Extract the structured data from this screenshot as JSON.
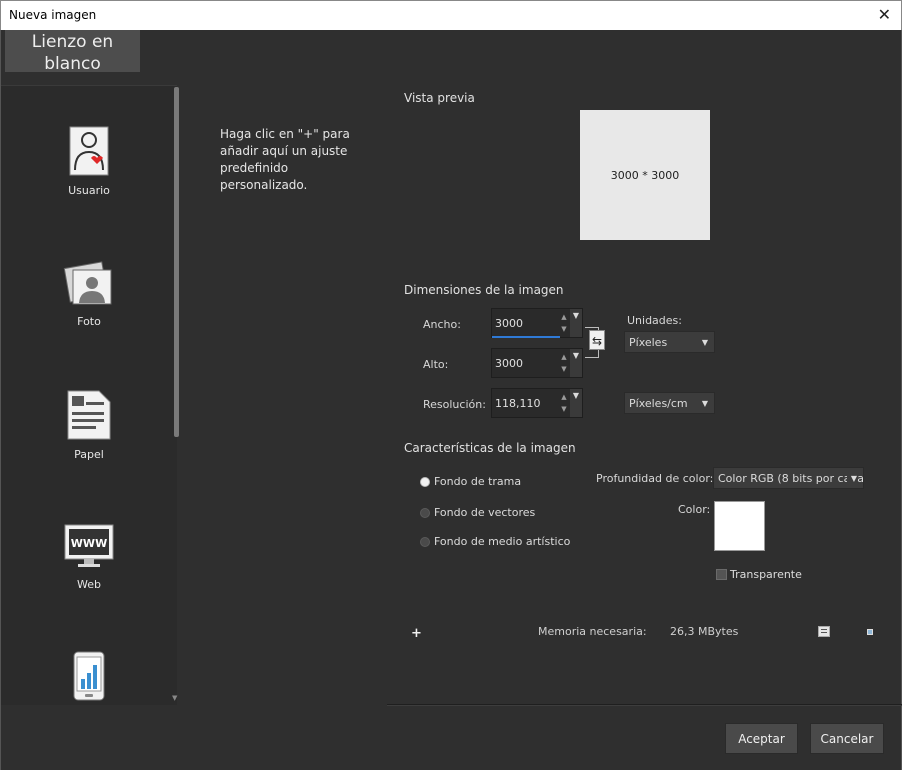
{
  "window": {
    "title": "Nueva imagen",
    "close_glyph": "✕"
  },
  "top_tab": {
    "label": "Lienzo en blanco"
  },
  "presets": [
    {
      "label": "Usuario",
      "icon": "user-icon"
    },
    {
      "label": "Foto",
      "icon": "photo-icon"
    },
    {
      "label": "Papel",
      "icon": "paper-icon"
    },
    {
      "label": "Web",
      "icon": "web-icon"
    },
    {
      "label": "",
      "icon": "mobile-icon"
    }
  ],
  "hint": "Haga clic en \"+\" para añadir aquí un ajuste predefinido personalizado.",
  "preview": {
    "title": "Vista previa",
    "text": "3000 * 3000"
  },
  "dimensions": {
    "title": "Dimensiones de la imagen",
    "width_label": "Ancho:",
    "width_value": "3000",
    "height_label": "Alto:",
    "height_value": "3000",
    "resolution_label": "Resolución:",
    "resolution_value": "118,110",
    "units_label": "Unidades:",
    "units_value": "Píxeles",
    "res_units_value": "Píxeles/cm",
    "link_glyph": "⇆"
  },
  "characteristics": {
    "title": "Características de la imagen",
    "radio1": "Fondo de trama",
    "radio2": "Fondo de vectores",
    "radio3": "Fondo de medio artístico",
    "depth_label": "Profundidad de color:",
    "depth_value": "Color RGB (8 bits por cana",
    "color_label": "Color:",
    "transparent_label": "Transparente",
    "swatch_color": "#ffffff"
  },
  "memory": {
    "plus_glyph": "+",
    "label": "Memoria necesaria:",
    "value": "26,3 MBytes"
  },
  "buttons": {
    "ok": "Aceptar",
    "cancel": "Cancelar"
  },
  "glyphs": {
    "caret": "▼",
    "up": "▲",
    "down": "▼"
  }
}
